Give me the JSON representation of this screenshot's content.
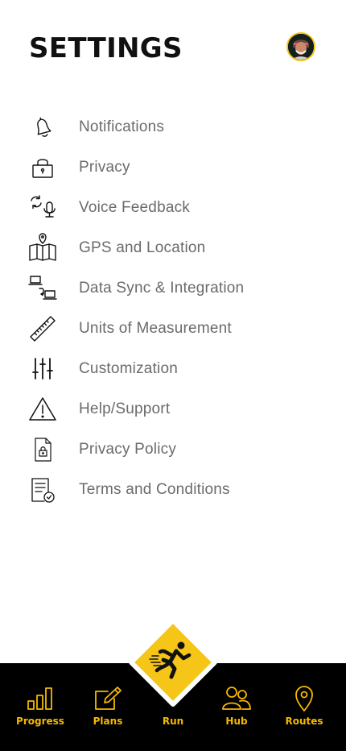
{
  "header": {
    "title": "SETTINGS"
  },
  "menu": {
    "items": [
      {
        "label": "Notifications",
        "icon": "bell-icon"
      },
      {
        "label": "Privacy",
        "icon": "lock-icon"
      },
      {
        "label": "Voice Feedback",
        "icon": "sync-microphone-icon"
      },
      {
        "label": "GPS and Location",
        "icon": "map-pin-icon"
      },
      {
        "label": "Data Sync & Integration",
        "icon": "laptop-sync-icon"
      },
      {
        "label": "Units of Measurement",
        "icon": "ruler-icon"
      },
      {
        "label": "Customization",
        "icon": "sliders-icon"
      },
      {
        "label": "Help/Support",
        "icon": "warning-icon"
      },
      {
        "label": "Privacy Policy",
        "icon": "locked-document-icon"
      },
      {
        "label": "Terms and Conditions",
        "icon": "checked-document-icon"
      }
    ]
  },
  "tabbar": {
    "progress": "Progress",
    "plans": "Plans",
    "run": "Run",
    "hub": "Hub",
    "routes": "Routes"
  },
  "colors": {
    "accent": "#f5b800",
    "run_button": "#f5c518",
    "tabbar_background": "#000000",
    "label_text": "#6b6b6b",
    "title_text": "#111111"
  }
}
